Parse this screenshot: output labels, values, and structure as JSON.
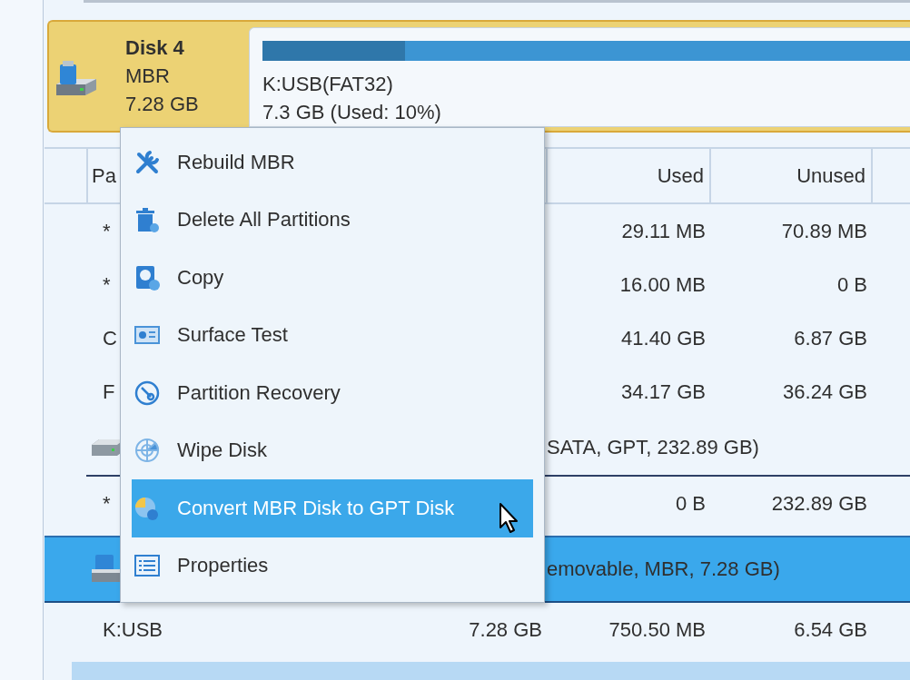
{
  "disk_card": {
    "name": "Disk 4",
    "scheme": "MBR",
    "size": "7.28 GB",
    "selected": true,
    "partition": {
      "label": "K:USB(FAT32)",
      "info": "7.3 GB (Used: 10%)",
      "level": 0.22
    }
  },
  "table": {
    "columns": [
      {
        "label": "Pa"
      },
      {
        "label": "Used"
      },
      {
        "label": "Unused"
      }
    ],
    "rows": [
      {
        "kind": "partition",
        "name": "*",
        "used": "29.11 MB",
        "unused": "70.89 MB"
      },
      {
        "kind": "partition",
        "name": "*",
        "used": "16.00 MB",
        "unused": "0 B"
      },
      {
        "kind": "partition",
        "name": "C",
        "used": "41.40 GB",
        "unused": "6.87 GB"
      },
      {
        "kind": "partition",
        "name": "F",
        "used": "34.17 GB",
        "unused": "36.24 GB"
      },
      {
        "kind": "disk",
        "info": "SATA, GPT, 232.89 GB)",
        "selected": false
      },
      {
        "kind": "partition",
        "name": "*",
        "used": "0 B",
        "unused": "232.89 GB"
      },
      {
        "kind": "disk",
        "info": "emovable, MBR, 7.28 GB)",
        "selected": true
      },
      {
        "kind": "partition",
        "name": "K:USB",
        "capacity": "7.28 GB",
        "used": "750.50 MB",
        "unused": "6.54 GB"
      }
    ]
  },
  "context_menu": {
    "items": [
      {
        "label": "Rebuild MBR",
        "selected": false
      },
      {
        "label": "Delete All Partitions",
        "selected": false
      },
      {
        "label": "Copy",
        "selected": false
      },
      {
        "label": "Surface Test",
        "selected": false
      },
      {
        "label": "Partition Recovery",
        "selected": false
      },
      {
        "label": "Wipe Disk",
        "selected": false
      },
      {
        "label": "Convert MBR Disk to GPT Disk",
        "selected": true
      },
      {
        "label": "Properties",
        "selected": false
      }
    ]
  }
}
